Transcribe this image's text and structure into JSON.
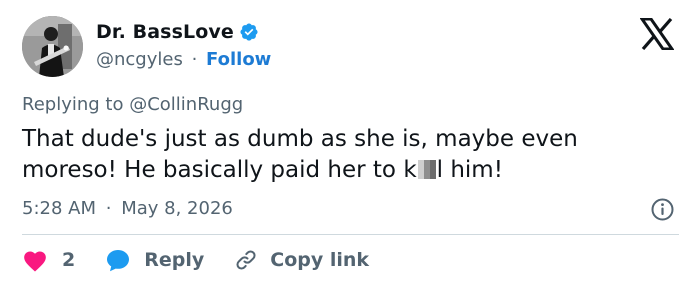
{
  "author": {
    "display_name": "Dr. BassLove",
    "handle": "@ncgyles",
    "separator": "·",
    "follow_label": "Follow"
  },
  "reply_context": {
    "prefix": "Replying to",
    "mention": "@CollinRugg"
  },
  "tweet": {
    "line1": "That dude's just as dumb as she is, maybe even",
    "line2_before": "moreso! He basically paid her to k",
    "line2_after": "l him!"
  },
  "meta": {
    "time": "5:28 AM",
    "separator": "·",
    "date": "May 8, 2026"
  },
  "actions": {
    "like_count": "2",
    "reply_label": "Reply",
    "copy_label": "Copy link"
  },
  "colors": {
    "accent": "#1d9bf0",
    "like": "#f91880",
    "text": "#0f1419",
    "muted": "#536471",
    "divider": "#cfd9de"
  },
  "icons": {
    "verified": "verified-badge-icon",
    "brand": "x-logo-icon",
    "info": "info-icon",
    "like": "heart-icon",
    "reply": "reply-bubble-icon",
    "copy": "link-icon"
  }
}
